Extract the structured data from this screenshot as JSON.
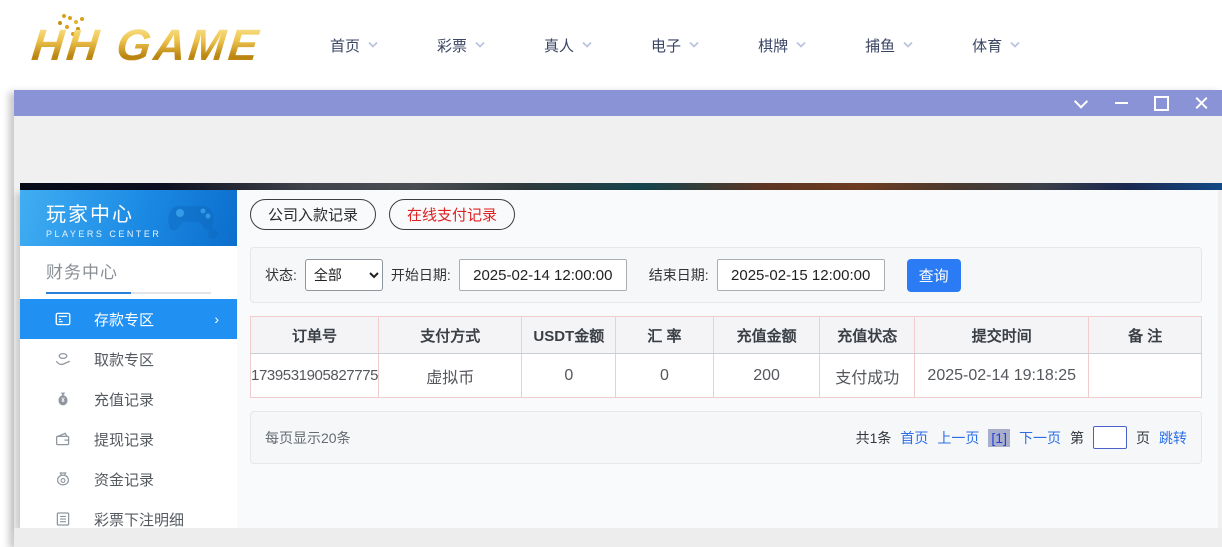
{
  "brand": {
    "logo_text": "HH GAME"
  },
  "nav": {
    "items": [
      {
        "label": "首页"
      },
      {
        "label": "彩票"
      },
      {
        "label": "真人"
      },
      {
        "label": "电子"
      },
      {
        "label": "棋牌"
      },
      {
        "label": "捕鱼"
      },
      {
        "label": "体育"
      }
    ]
  },
  "sidebar": {
    "title": "玩家中心",
    "subtitle": "PLAYERS CENTER",
    "section_label": "财务中心",
    "items": [
      {
        "label": "存款专区",
        "active": true
      },
      {
        "label": "取款专区",
        "active": false
      },
      {
        "label": "充值记录",
        "active": false
      },
      {
        "label": "提现记录",
        "active": false
      },
      {
        "label": "资金记录",
        "active": false
      },
      {
        "label": "彩票下注明细",
        "active": false
      }
    ]
  },
  "tabs": [
    {
      "label": "公司入款记录"
    },
    {
      "label": "在线支付记录"
    }
  ],
  "filters": {
    "status_label": "状态:",
    "status_value": "全部",
    "start_label": "开始日期:",
    "start_value": "2025-02-14 12:00:00",
    "end_label": "结束日期:",
    "end_value": "2025-02-15 12:00:00",
    "search_button": "查询"
  },
  "table": {
    "headers": [
      "订单号",
      "支付方式",
      "USDT金额",
      "汇 率",
      "充值金额",
      "充值状态",
      "提交时间",
      "备 注"
    ],
    "rows": [
      [
        "1739531905827775",
        "虚拟币",
        "0",
        "0",
        "200",
        "支付成功",
        "2025-02-14 19:18:25",
        ""
      ]
    ]
  },
  "pagination": {
    "page_size_text": "每页显示20条",
    "total_text": "共1条",
    "first_label": "首页",
    "prev_label": "上一页",
    "current_page": "[1]",
    "next_label": "下一页",
    "jump_prefix": "第",
    "jump_suffix": "页",
    "jump_label": "跳转"
  },
  "colors": {
    "titlebar": "#8a93d5",
    "sidebar_active": "#2090f3",
    "banner_blue": "#1b8ae4",
    "query_button": "#2b7bf5",
    "tab_red_text": "#e02222",
    "link_blue": "#2a6fe8",
    "logo_gold": "#d9a21b",
    "table_border_pink": "#f0cccc"
  }
}
